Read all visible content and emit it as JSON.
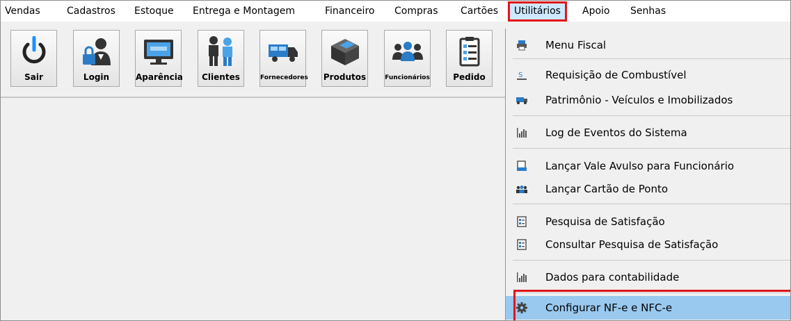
{
  "menubar": {
    "items": [
      "Vendas",
      "Cadastros",
      "Estoque",
      "Entrega e Montagem",
      "Financeiro",
      "Compras",
      "Cartões",
      "Utilitários",
      "Apoio",
      "Senhas"
    ]
  },
  "toolbar": {
    "buttons": [
      {
        "label": "Sair",
        "icon": "power-icon"
      },
      {
        "label": "Login",
        "icon": "user-lock-icon"
      },
      {
        "label": "Aparência",
        "icon": "monitor-icon"
      },
      {
        "label": "Clientes",
        "icon": "customers-icon"
      },
      {
        "label": "Fornecedores",
        "icon": "truck-icon"
      },
      {
        "label": "Produtos",
        "icon": "box-icon"
      },
      {
        "label": "Funcionários",
        "icon": "employees-icon"
      },
      {
        "label": "Pedido",
        "icon": "clipboard-icon"
      }
    ]
  },
  "dropdown": {
    "items": [
      {
        "label": "Menu Fiscal",
        "icon": "printer-icon"
      },
      {
        "label": "Requisição de Combustível",
        "icon": "fuel-icon"
      },
      {
        "label": "Patrimônio - Veículos e Imobilizados",
        "icon": "vehicle-icon"
      },
      {
        "label": "Log de Eventos do Sistema",
        "icon": "chart-icon"
      },
      {
        "label": "Lançar Vale Avulso para Funcionário",
        "icon": "voucher-icon"
      },
      {
        "label": "Lançar Cartão de Ponto",
        "icon": "team-icon"
      },
      {
        "label": "Pesquisa de Satisfação",
        "icon": "survey-icon"
      },
      {
        "label": "Consultar Pesquisa de Satisfação",
        "icon": "survey-icon"
      },
      {
        "label": "Dados para contabilidade",
        "icon": "chart-icon"
      },
      {
        "label": "Configurar NF-e e NFC-e",
        "icon": "gear-icon"
      }
    ]
  },
  "colors": {
    "highlight": "#99c9ef",
    "annotation_red": "#e3141b",
    "active_menu": "#cde8ff"
  }
}
